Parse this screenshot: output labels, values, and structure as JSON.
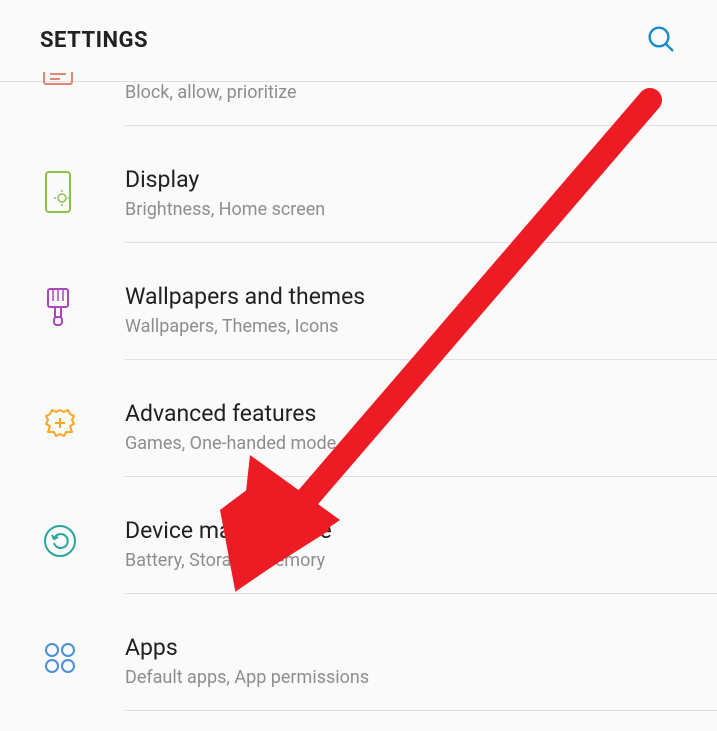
{
  "header": {
    "title": "SETTINGS"
  },
  "items": [
    {
      "title": "",
      "subtitle": "Block, allow, prioritize",
      "icon_name": "notifications-icon",
      "icon_color": "#e5846f"
    },
    {
      "title": "Display",
      "subtitle": "Brightness, Home screen",
      "icon_name": "display-icon",
      "icon_color": "#8bc34a"
    },
    {
      "title": "Wallpapers and themes",
      "subtitle": "Wallpapers, Themes, Icons",
      "icon_name": "brush-icon",
      "icon_color": "#ab47bc"
    },
    {
      "title": "Advanced features",
      "subtitle": "Games, One-handed mode",
      "icon_name": "gear-plus-icon",
      "icon_color": "#f9a825"
    },
    {
      "title": "Device maintenance",
      "subtitle": "Battery, Storage, Memory",
      "icon_name": "power-cycle-icon",
      "icon_color": "#26a69a"
    },
    {
      "title": "Apps",
      "subtitle": "Default apps, App permissions",
      "icon_name": "apps-icon",
      "icon_color": "#4a8fd6"
    }
  ],
  "annotation": {
    "type": "arrow",
    "color": "#ed1c24",
    "target": "apps-item"
  }
}
